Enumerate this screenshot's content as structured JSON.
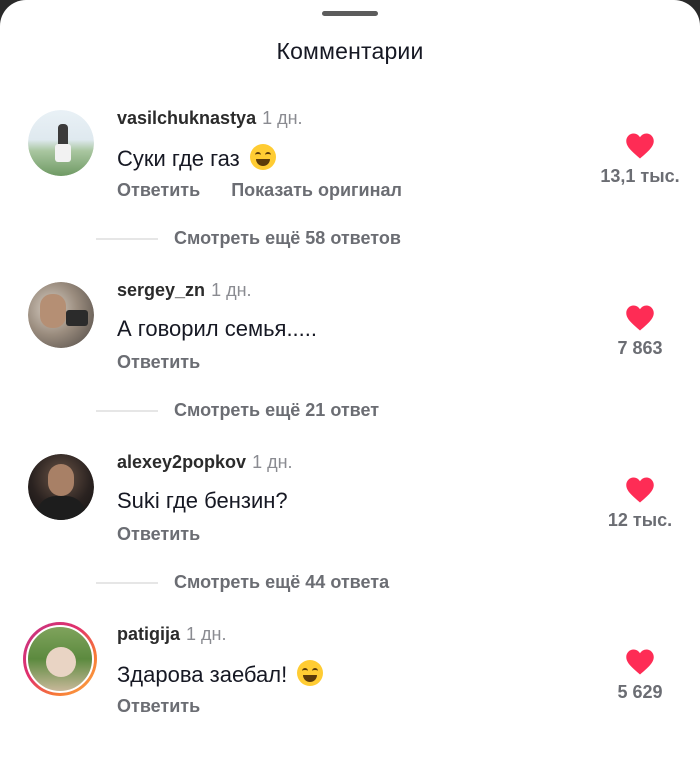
{
  "header": {
    "title": "Комментарии"
  },
  "comments": [
    {
      "username": "vasilchuknastya",
      "time": "1 дн.",
      "text": "Суки где газ",
      "emoji": "rofl-emoji",
      "reply_label": "Ответить",
      "show_original_label": "Показать оригинал",
      "likes": "13,1 тыс.",
      "more_replies": "Смотреть ещё 58 ответов"
    },
    {
      "username": "sergey_zn",
      "time": "1 дн.",
      "text": "А говорил семья.....",
      "reply_label": "Ответить",
      "likes": "7 863",
      "more_replies": "Смотреть ещё 21 ответ"
    },
    {
      "username": "alexey2popkov",
      "time": "1 дн.",
      "text": "Suki где бензин?",
      "reply_label": "Ответить",
      "likes": "12 тыс.",
      "more_replies": "Смотреть ещё 44 ответа"
    },
    {
      "username": "patigija",
      "time": "1 дн.",
      "text": "Здарова заебал!",
      "emoji": "laughing-emoji",
      "reply_label": "Ответить",
      "likes": "5 629"
    }
  ],
  "colors": {
    "heart": "#fe2c55",
    "muted": "#6b6d73",
    "text": "#161823"
  }
}
